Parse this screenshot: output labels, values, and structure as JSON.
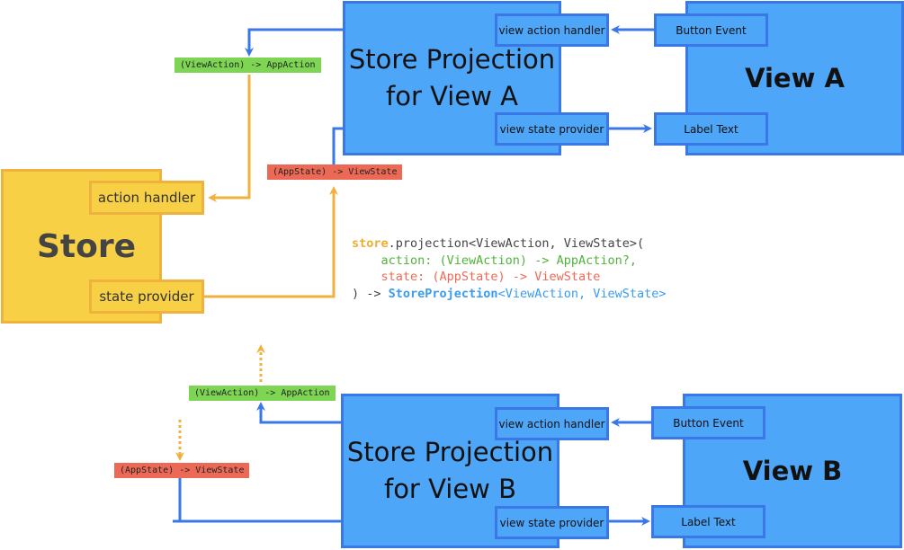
{
  "colors": {
    "blue_fill": "#4da6f8",
    "blue_stroke": "#3b78e7",
    "yellow_fill": "#f7d046",
    "yellow_stroke": "#f0b23e",
    "green_tag": "#7ed553",
    "red_tag": "#ec6a55"
  },
  "store": {
    "title": "Store",
    "action_handler": "action handler",
    "state_provider": "state provider"
  },
  "projection_a": {
    "title_line1": "Store Projection",
    "title_line2": "for View A",
    "view_action_handler": "view action handler",
    "view_state_provider": "view state provider"
  },
  "view_a": {
    "title": "View A",
    "button_event": "Button Event",
    "label_text": "Label Text"
  },
  "projection_b": {
    "title_line1": "Store Projection",
    "title_line2": "for View B",
    "view_action_handler": "view action handler",
    "view_state_provider": "view state provider"
  },
  "view_b": {
    "title": "View B",
    "button_event": "Button Event",
    "label_text": "Label Text"
  },
  "tags": {
    "action_a": "(ViewAction) -> AppAction",
    "state_a": "(AppState) -> ViewState",
    "action_b": "(ViewAction) -> AppAction",
    "state_b": "(AppState) -> ViewState"
  },
  "code": {
    "l1_store": "store",
    "l1_rest": ".projection<ViewAction, ViewState>(",
    "l2": "    action: (ViewAction) -> AppAction?,",
    "l3": "    state: (AppState) -> ViewState",
    "l4_prefix": ") -> ",
    "l4_type": "StoreProjection",
    "l4_generics": "<ViewAction, ViewState>"
  }
}
